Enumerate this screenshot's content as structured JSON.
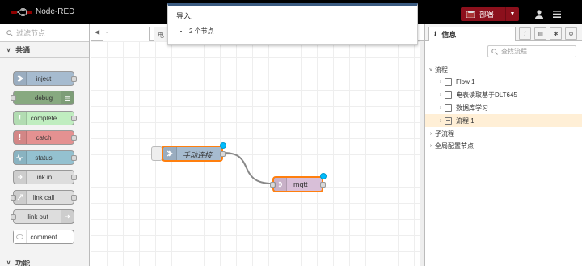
{
  "header": {
    "app_title": "Node-RED",
    "deploy_label": "部署",
    "user_icon": "user-icon",
    "menu_icon": "hamburger-menu-icon"
  },
  "palette": {
    "filter_placeholder": "过滤节点",
    "category_common": "共通",
    "category_function": "功能",
    "nodes": [
      {
        "label": "inject",
        "color": "#a6bbcf"
      },
      {
        "label": "debug",
        "color": "#87a980"
      },
      {
        "label": "complete",
        "color": "#c0edc0"
      },
      {
        "label": "catch",
        "color": "#e49191"
      },
      {
        "label": "status",
        "color": "#94c1d0"
      },
      {
        "label": "link in",
        "color": "#dddddd"
      },
      {
        "label": "link call",
        "color": "#dddddd"
      },
      {
        "label": "link out",
        "color": "#dddddd"
      },
      {
        "label": "comment",
        "color": "#ffffff"
      }
    ]
  },
  "workspace": {
    "tabs": [
      {
        "label": "1"
      },
      {
        "label": "电"
      }
    ],
    "flow_nodes": [
      {
        "label": "手动连接",
        "type": "inject",
        "color": "#a6bbcf"
      },
      {
        "label": "mqtt",
        "type": "mqtt out",
        "color": "#d8bfd8"
      }
    ]
  },
  "notification": {
    "title": "导入:",
    "item": "2 个节点"
  },
  "sidebar": {
    "tab_label": "信息",
    "search_placeholder": "查找流程",
    "tree": {
      "flows_header": "流程",
      "flows": [
        "Flow 1",
        "电表读取基于DLT645",
        "数据库学习",
        "流程 1"
      ],
      "subflows_header": "子流程",
      "global_config_header": "全局配置节点"
    }
  },
  "colors": {
    "header_bg": "#000000",
    "deploy_bg": "#8c101c",
    "selection_orange": "#ff7f0e",
    "changed_badge": "#00bcff",
    "selected_row_bg": "#ffefd6",
    "notification_accent": "#3a5a80"
  }
}
